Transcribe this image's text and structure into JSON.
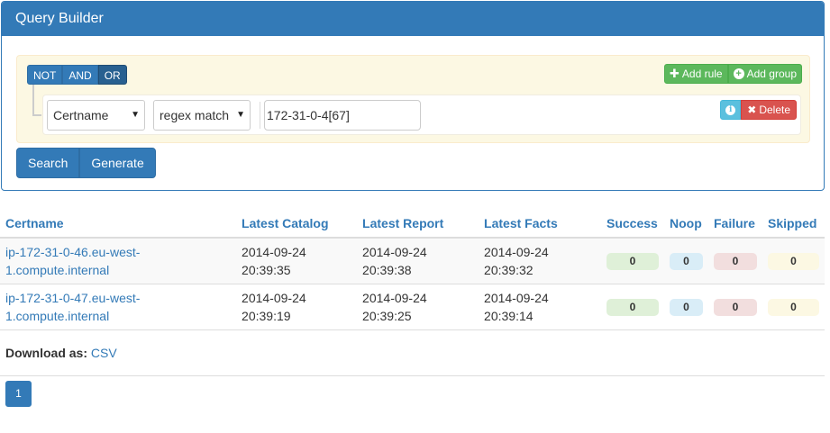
{
  "panel": {
    "title": "Query Builder"
  },
  "query_builder": {
    "conditions": [
      "NOT",
      "AND",
      "OR"
    ],
    "add_rule_label": "Add rule",
    "add_group_label": "Add group",
    "rule": {
      "field": "Certname",
      "operator": "regex match",
      "value": "172-31-0-4[67]",
      "delete_label": "Delete"
    }
  },
  "actions": {
    "search_label": "Search",
    "generate_label": "Generate"
  },
  "table": {
    "headers": [
      "Certname",
      "Latest Catalog",
      "Latest Report",
      "Latest Facts",
      "Success",
      "Noop",
      "Failure",
      "Skipped"
    ],
    "rows": [
      {
        "certname_line1": "ip-172-31-0-46.eu-west-",
        "certname_line2": "1.compute.internal",
        "catalog_date": "2014-09-24",
        "catalog_time": "20:39:35",
        "report_date": "2014-09-24",
        "report_time": "20:39:38",
        "facts_date": "2014-09-24",
        "facts_time": "20:39:32",
        "success": "0",
        "noop": "0",
        "failure": "0",
        "skipped": "0"
      },
      {
        "certname_line1": "ip-172-31-0-47.eu-west-",
        "certname_line2": "1.compute.internal",
        "catalog_date": "2014-09-24",
        "catalog_time": "20:39:19",
        "report_date": "2014-09-24",
        "report_time": "20:39:25",
        "facts_date": "2014-09-24",
        "facts_time": "20:39:14",
        "success": "0",
        "noop": "0",
        "failure": "0",
        "skipped": "0"
      }
    ],
    "download_label": "Download as:",
    "download_link": "CSV"
  },
  "pagination": {
    "current_page": "1"
  },
  "colors": {
    "primary": "#337ab7",
    "success": "#5cb85c",
    "info": "#5bc0de",
    "danger": "#d9534f",
    "qb_background": "#fcf8e3"
  }
}
